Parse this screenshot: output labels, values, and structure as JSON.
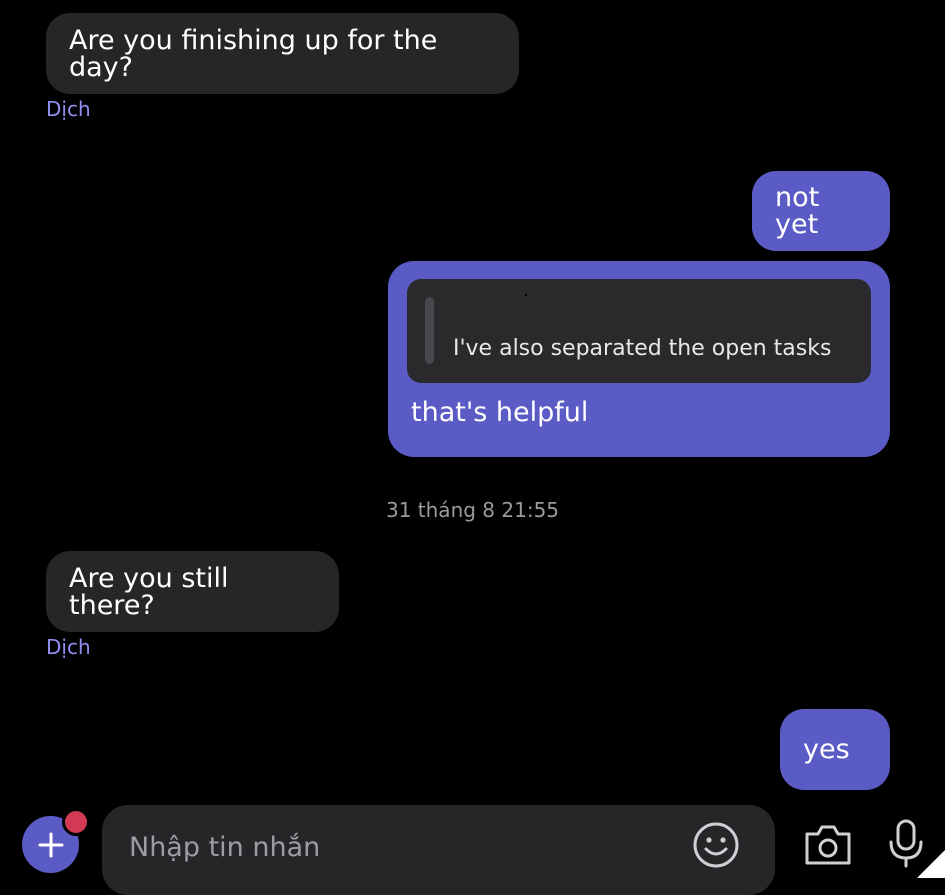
{
  "messages": [
    {
      "id": "m1",
      "direction": "incoming",
      "text": "Are you finishing up for the day?",
      "translate_label": "Dịch"
    },
    {
      "id": "m2",
      "direction": "outgoing",
      "text": "not yet"
    },
    {
      "id": "m3",
      "direction": "outgoing",
      "quoted_text": "I've also separated the open tasks",
      "text": "that's helpful"
    },
    {
      "id": "m4",
      "direction": "incoming",
      "text": "Are you still there?",
      "translate_label": "Dịch"
    },
    {
      "id": "m5",
      "direction": "outgoing",
      "text": "yes"
    }
  ],
  "timestamp": "31 tháng 8 21:55",
  "composer": {
    "placeholder": "Nhập tin nhắn",
    "icons": [
      "plus-icon",
      "emoji-icon",
      "camera-icon",
      "microphone-icon"
    ]
  },
  "colors": {
    "background": "#000000",
    "incoming_bubble": "#262628",
    "outgoing_bubble": "#5b5bc6",
    "translate_link": "#8f8ff0",
    "badge": "#d13a52"
  }
}
